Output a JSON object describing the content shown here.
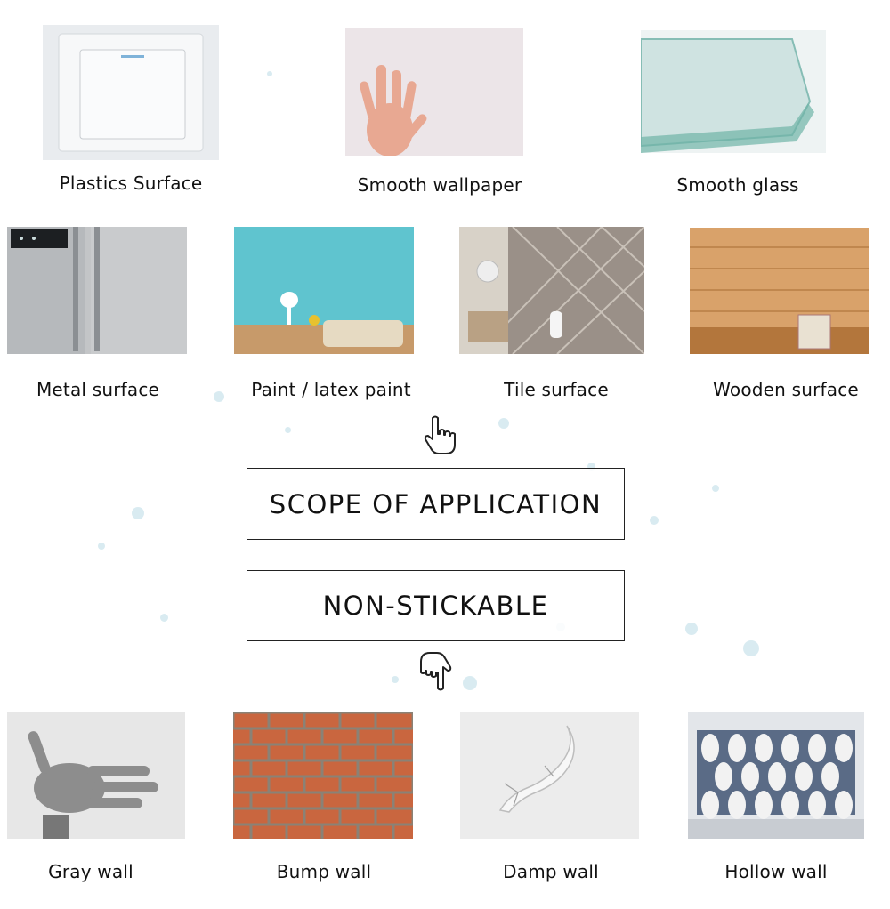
{
  "suitable": [
    {
      "label": "Plastics Surface",
      "icon": "light-switch-icon"
    },
    {
      "label": "Smooth wallpaper",
      "icon": "hand-on-wall-icon"
    },
    {
      "label": "Smooth glass",
      "icon": "glass-pane-icon"
    },
    {
      "label": "Metal surface",
      "icon": "refrigerator-icon"
    },
    {
      "label": "Paint / latex paint",
      "icon": "painted-room-icon"
    },
    {
      "label": "Tile surface",
      "icon": "bathroom-tile-icon"
    },
    {
      "label": "Wooden surface",
      "icon": "wood-panel-icon"
    }
  ],
  "scope_title": "SCOPE OF APPLICATION",
  "nonstick_title": "NON-STICKABLE",
  "unsuitable": [
    {
      "label": "Gray wall",
      "icon": "gray-hand-icon"
    },
    {
      "label": "Bump wall",
      "icon": "brick-wall-icon"
    },
    {
      "label": "Damp wall",
      "icon": "cracked-wall-icon"
    },
    {
      "label": "Hollow wall",
      "icon": "lattice-wall-icon"
    }
  ],
  "colors": {
    "border": "#222222",
    "splash": "#b9dbe6",
    "text": "#111111"
  }
}
